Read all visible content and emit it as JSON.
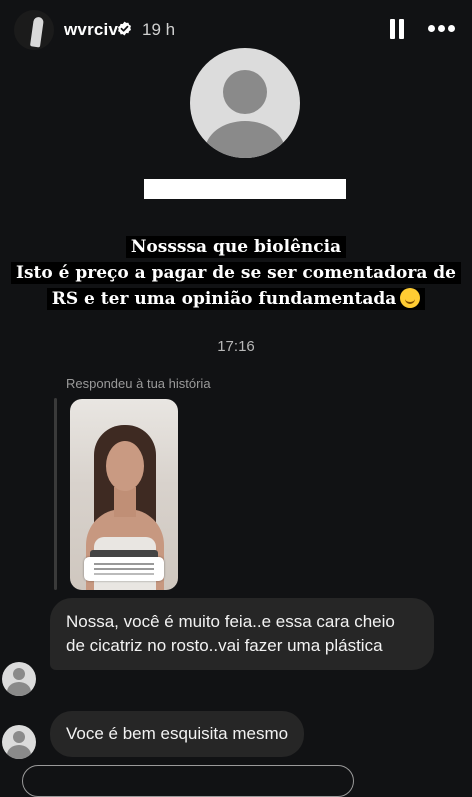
{
  "header": {
    "username": "wvrciv",
    "time_ago": "19 h",
    "verified_icon": "verified-badge-icon",
    "pause_icon": "pause-icon",
    "more_icon": "more-options-icon"
  },
  "caption": {
    "line1": "Nossssa que biolência",
    "line2": "Isto é preço a pagar de se ser comentadora de",
    "line3": "RS e ter uma opinião fundamentada",
    "emoji": "smiling-face-icon"
  },
  "chat": {
    "timestamp": "17:16",
    "replied_label": "Respondeu à tua história",
    "messages": [
      "Nossa, você é muito feia..e essa cara cheio de cicatriz no rosto..vai fazer uma plástica",
      "Voce é bem esquisita mesmo"
    ]
  },
  "colors": {
    "background": "#111214",
    "bubble": "#262626",
    "caption_highlight": "#000000"
  }
}
